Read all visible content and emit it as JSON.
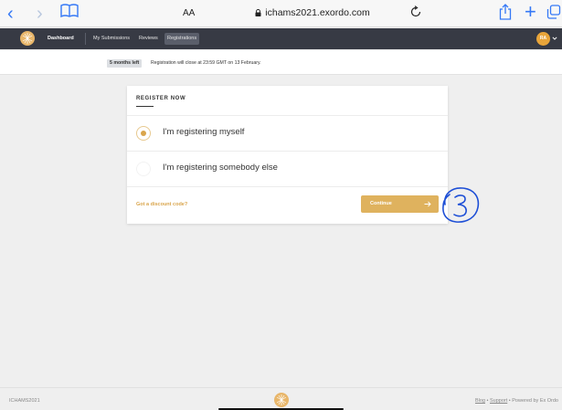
{
  "browser": {
    "aa_label": "AA",
    "url": "ichams2021.exordo.com",
    "icons": [
      "back-icon",
      "forward-icon",
      "bookmarks-icon",
      "lock-icon",
      "reload-icon",
      "share-icon",
      "new-tab-icon",
      "tabs-icon"
    ]
  },
  "nav": {
    "dashboard": "Dashboard",
    "submissions": "My Submissions",
    "reviews": "Reviews",
    "registrations": "Registrations",
    "avatar_initials": "RA"
  },
  "info": {
    "badge": "5 months left",
    "text": "Registration will close at 23:59 GMT on 13 February."
  },
  "register": {
    "title": "REGISTER NOW",
    "options": [
      {
        "label": "I'm registering myself",
        "selected": true
      },
      {
        "label": "I'm registering somebody else",
        "selected": false
      }
    ],
    "discount_link": "Got a discount code?",
    "continue_label": "Continue"
  },
  "annotation": {
    "text": "3"
  },
  "footer": {
    "left": "ICHAMS2021",
    "blog": "Blog",
    "support": "Support",
    "separator": "•",
    "powered": "Powered by Ex Ordo"
  },
  "colors": {
    "accent": "#dfb25e",
    "nav_bg": "#373a44",
    "safari_blue": "#3478f6",
    "annotation_blue": "#1e4fd6"
  }
}
